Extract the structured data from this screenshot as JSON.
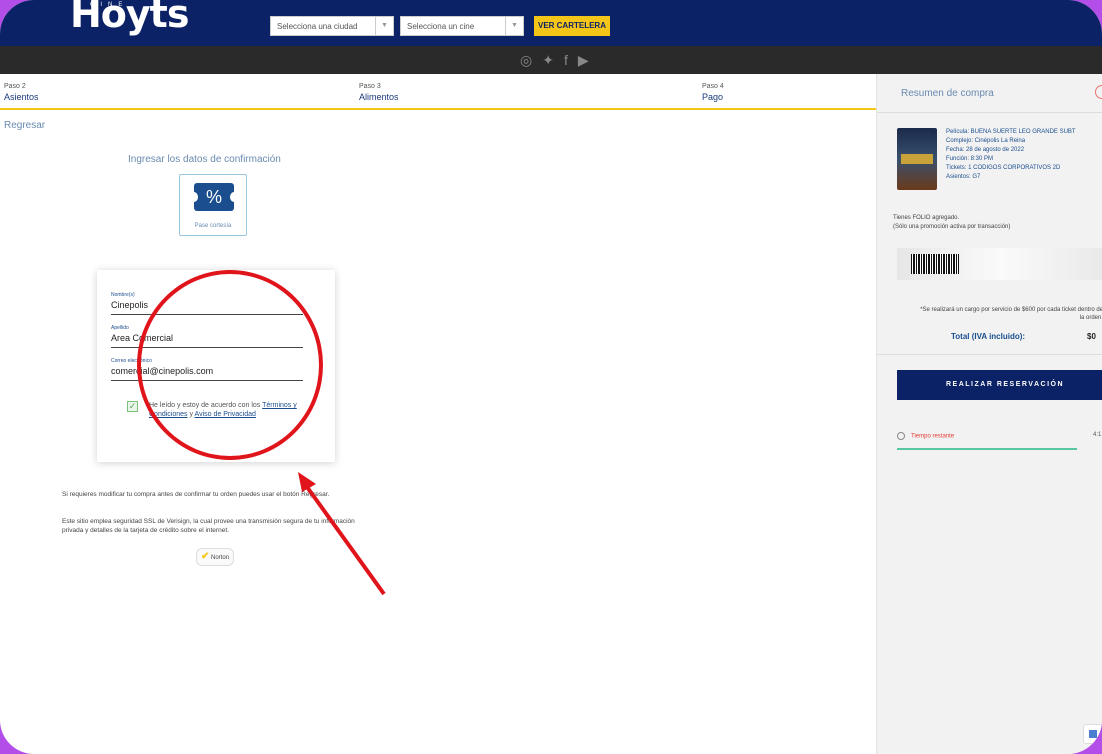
{
  "header": {
    "logo": "Hoyts",
    "logo_sup": "CINE",
    "city_select": "Selecciona una ciudad",
    "cinema_select": "Selecciona un cine",
    "cartelera_button": "VER CARTELERA",
    "social_icons": [
      "instagram-icon",
      "twitter-icon",
      "facebook-icon",
      "youtube-icon"
    ]
  },
  "steps": [
    {
      "num": "Paso 2",
      "name": "Asientos"
    },
    {
      "num": "Paso 3",
      "name": "Alimentos"
    },
    {
      "num": "Paso 4",
      "name": "Pago"
    }
  ],
  "back_link": "Regresar",
  "confirm_title": "Ingresar los datos de confirmación",
  "pase": {
    "symbol": "%",
    "label": "Pase cortesía"
  },
  "form": {
    "name_label": "Nombre(s)",
    "name_value": "Cinepolis",
    "lastname_label": "Apellido",
    "lastname_value": "Area Comercial",
    "email_label": "Correo electrónico",
    "email_value": "comercial@cinepolis.com",
    "terms_pre": "He leído y estoy de acuerdo con los",
    "terms_link": "Términos y Condiciones",
    "terms_and": "y",
    "privacy_link": "Aviso de Privacidad"
  },
  "notes": {
    "modify": "Si requieres modificar tu compra antes de confirmar tu orden puedes usar el botón Regresar.",
    "ssl": "Este sitio emplea seguridad SSL de Verisign, la cual provee una transmisión segura de tu información privada y detalles de la tarjeta de crédito sobre el internet."
  },
  "norton_label": "Norton",
  "summary": {
    "title": "Resumen de compra",
    "movie": "Película: BUENA SUERTE LEO GRANDE SUBT",
    "complex": "Complejo: Cinépolis La Reina",
    "date": "Fecha: 28 de agosto de 2022",
    "showtime": "Función: 8:30 PM",
    "tickets": "Tickets: 1 CODIGOS CORPORATIVOS 2D",
    "seats": "Asientos: G7",
    "folio_line1": "Tienes FOLIO agregado.",
    "folio_line2": "(Sólo una promoción activa por transacción)",
    "charge_note": "*Se realizará un cargo por servicio de $600 por cada ticket dentro de la orden.",
    "total_label": "Total (IVA incluido):",
    "total_value": "$0",
    "reserve_button": "REALIZAR RESERVACIÓN",
    "timer_label": "Tiempo restante",
    "timer_value": "4:1"
  }
}
